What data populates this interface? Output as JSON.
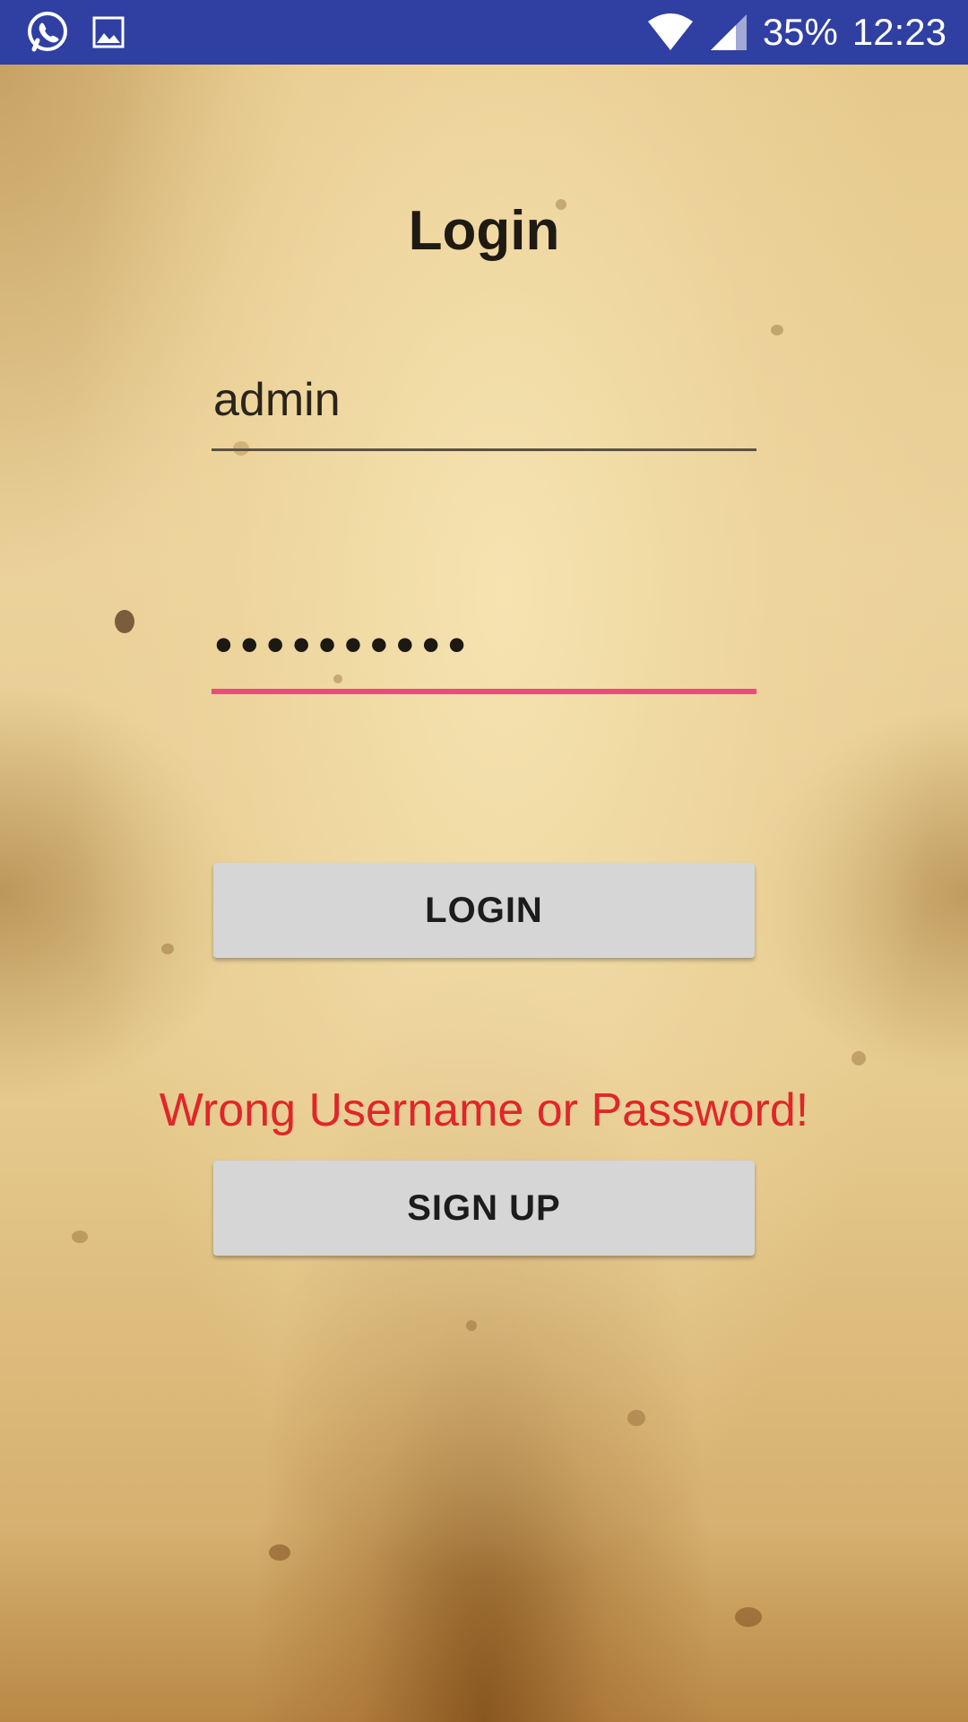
{
  "status_bar": {
    "battery": "35%",
    "time": "12:23",
    "icons": [
      "whatsapp-icon",
      "image-icon",
      "wifi-icon",
      "signal-icon"
    ]
  },
  "login_screen": {
    "title": "Login",
    "username": {
      "value": "admin"
    },
    "password": {
      "masked_value": "••••••••••",
      "underline_color": "#ee4a79"
    },
    "login_button_label": "LOGIN",
    "error_message": "Wrong Username or Password!",
    "error_color": "#e0262a",
    "signup_button_label": "SIGN UP"
  },
  "colors": {
    "status_bar": "#2f3fa2",
    "button_background": "#d6d6d6",
    "username_underline": "#5a5245"
  }
}
